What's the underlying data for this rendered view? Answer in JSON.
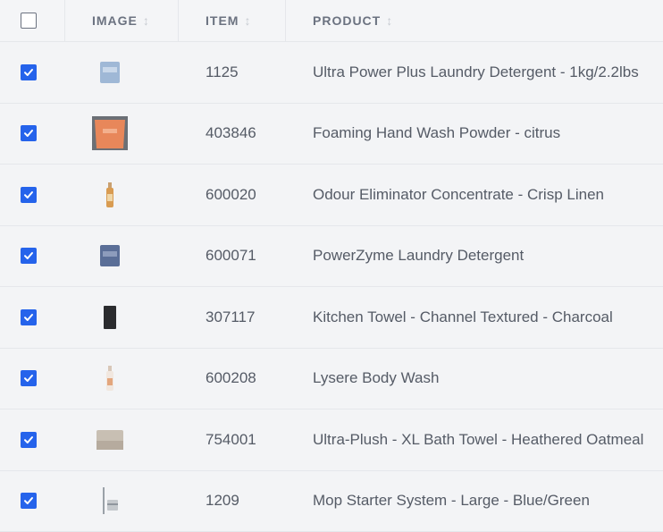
{
  "header": {
    "image": "IMAGE",
    "item": "ITEM",
    "product": "PRODUCT",
    "select_all_checked": false
  },
  "rows": [
    {
      "item": "1125",
      "product": "Ultra Power Plus Laundry Detergent - 1kg/2.2lbs",
      "checked": true,
      "thumb": "blue-bag"
    },
    {
      "item": "403846",
      "product": "Foaming Hand Wash Powder - citrus",
      "checked": true,
      "thumb": "orange-pouch"
    },
    {
      "item": "600020",
      "product": "Odour Eliminator Concentrate - Crisp Linen",
      "checked": true,
      "thumb": "amber-bottle"
    },
    {
      "item": "600071",
      "product": "PowerZyme Laundry Detergent",
      "checked": true,
      "thumb": "navy-bag"
    },
    {
      "item": "307117",
      "product": "Kitchen Towel - Channel Textured - Charcoal",
      "checked": true,
      "thumb": "black-towel"
    },
    {
      "item": "600208",
      "product": "Lysere Body Wash",
      "checked": true,
      "thumb": "white-bottle"
    },
    {
      "item": "754001",
      "product": "Ultra-Plush - XL Bath Towel - Heathered Oatmeal",
      "checked": true,
      "thumb": "oatmeal-towel"
    },
    {
      "item": "1209",
      "product": "Mop Starter System - Large - Blue/Green",
      "checked": true,
      "thumb": "mop-kit"
    }
  ],
  "colors": {
    "accent": "#2563eb",
    "border": "#e5e7eb",
    "background": "#f3f4f6"
  }
}
